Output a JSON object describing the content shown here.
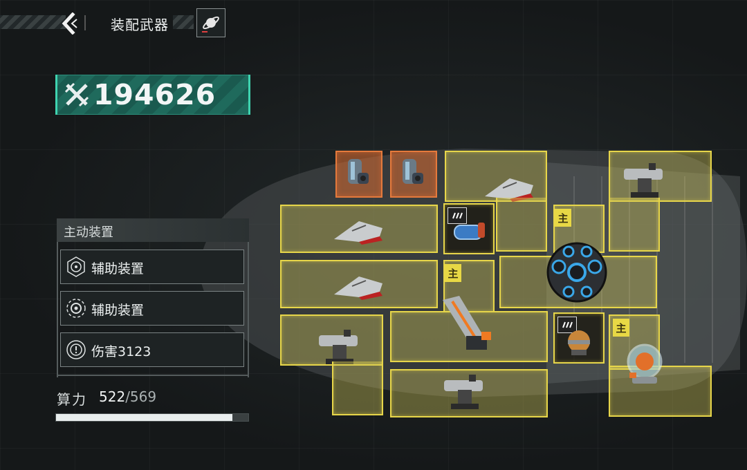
{
  "header": {
    "title": "装配武器"
  },
  "combat_power": {
    "value": "194626"
  },
  "active_equipment": {
    "header": "主动装置",
    "slots": [
      {
        "label": "辅助装置",
        "icon": "reticle-icon"
      },
      {
        "label": "辅助装置",
        "icon": "target-ring-icon"
      },
      {
        "label": "伤害3123",
        "icon": "damage-ring-icon"
      }
    ]
  },
  "compute": {
    "label": "算力",
    "current": "522",
    "max": "/569",
    "fill_fraction": 0.917
  },
  "grid": {
    "main_badge": "主",
    "colors": {
      "slot_fill": "#d2c85a",
      "slot_border": "#e7d64a",
      "slot_orange": "#e57a3c",
      "power_box": "#1f6a5c",
      "accent": "#3fd4b0"
    }
  }
}
